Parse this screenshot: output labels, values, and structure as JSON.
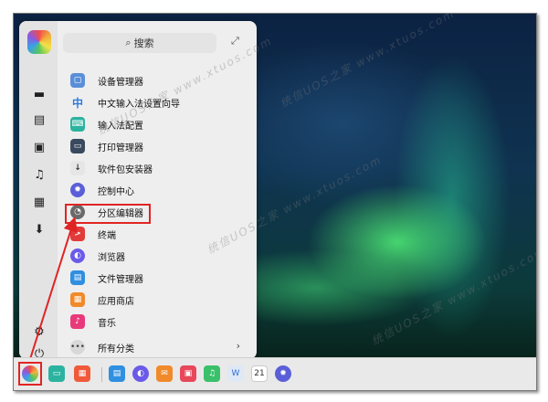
{
  "search": {
    "label": "搜索"
  },
  "apps": [
    {
      "label": "设备管理器",
      "icon": "device-manager-icon",
      "color": "#5a8fd8"
    },
    {
      "label": "中文输入法设置向导",
      "icon": "chinese-input-icon",
      "color": "#2f7ae0",
      "glyph": "中"
    },
    {
      "label": "输入法配置",
      "icon": "input-method-config-icon",
      "color": "#2bb3a0"
    },
    {
      "label": "打印管理器",
      "icon": "printer-icon",
      "color": "#3a4a5e"
    },
    {
      "label": "软件包安装器",
      "icon": "package-installer-icon",
      "color": "#e6e6e6"
    },
    {
      "label": "控制中心",
      "icon": "control-center-icon",
      "color": "#5a5fd8"
    },
    {
      "label": "分区编辑器",
      "icon": "partition-editor-icon",
      "color": "#6a6a6a"
    },
    {
      "label": "终端",
      "icon": "terminal-icon",
      "color": "#e23a3a"
    },
    {
      "label": "浏览器",
      "icon": "browser-icon",
      "color": "#6a5ae8"
    },
    {
      "label": "文件管理器",
      "icon": "file-manager-icon",
      "color": "#2f8fe0"
    },
    {
      "label": "应用商店",
      "icon": "app-store-icon",
      "color": "#f08a2a"
    },
    {
      "label": "音乐",
      "icon": "music-icon",
      "color": "#e83a7a"
    }
  ],
  "all_categories": {
    "label": "所有分类"
  },
  "taskbar": {
    "clock_day": "21"
  },
  "watermark": "统信UOS之家 www.xtuos.com"
}
